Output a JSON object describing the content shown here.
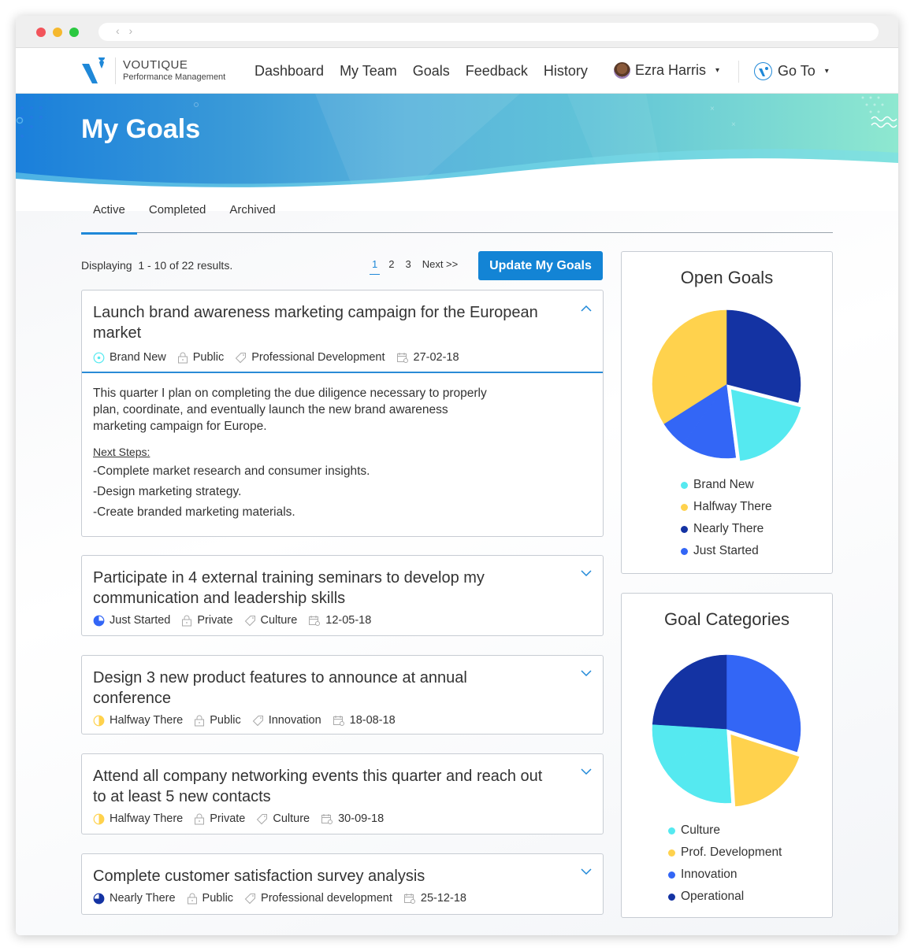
{
  "browser": {
    "nav_arrows": "‹ ›"
  },
  "brand": {
    "name": "VOUTIQUE",
    "subtitle": "Performance Management",
    "accent_color": "#1f88d8"
  },
  "nav": {
    "items": [
      {
        "label": "Dashboard"
      },
      {
        "label": "My Team"
      },
      {
        "label": "Goals"
      },
      {
        "label": "Feedback"
      },
      {
        "label": "History"
      }
    ],
    "user_name": "Ezra Harris",
    "user_caret": "▾",
    "goto_label": "Go To",
    "goto_caret": "▾"
  },
  "page": {
    "title": "My Goals"
  },
  "tabs": [
    {
      "label": "Active",
      "active": true
    },
    {
      "label": "Completed",
      "active": false
    },
    {
      "label": "Archived",
      "active": false
    }
  ],
  "results_text": "Displaying  1 - 10 of 22 results.",
  "pagination": {
    "pages": [
      "1",
      "2",
      "3"
    ],
    "current": "1",
    "next_label": "Next >>"
  },
  "update_button": "Update My Goals",
  "status_colors": {
    "Brand New": "#55e9f0",
    "Halfway There": "#ffd24d",
    "Nearly There": "#1433a3",
    "Just Started": "#3366f6"
  },
  "goals": [
    {
      "title": "Launch brand awareness marketing campaign for the European market",
      "status": "Brand New",
      "visibility": "Public",
      "category": "Professional Development",
      "date": "27-02-18",
      "expanded": true,
      "description": "This quarter I plan on completing the due diligence necessary to properly plan, coordinate, and eventually launch the new brand awareness marketing campaign for Europe.",
      "next_steps_heading": "Next Steps:",
      "next_steps": [
        "-Complete market research and consumer insights.",
        "-Design marketing strategy.",
        "-Create branded marketing materials."
      ]
    },
    {
      "title": "Participate in 4 external training seminars to develop my communication and leadership skills",
      "status": "Just Started",
      "visibility": "Private",
      "category": "Culture",
      "date": "12-05-18",
      "expanded": false
    },
    {
      "title": "Design 3 new product features to announce at annual conference",
      "status": "Halfway There",
      "visibility": "Public",
      "category": "Innovation",
      "date": "18-08-18",
      "expanded": false
    },
    {
      "title": "Attend all company networking events this quarter and reach out to at least 5 new contacts",
      "status": "Halfway There",
      "visibility": "Private",
      "category": "Culture",
      "date": "30-09-18",
      "expanded": false
    },
    {
      "title": "Complete customer satisfaction survey analysis",
      "status": "Nearly There",
      "visibility": "Public",
      "category": "Professional development",
      "date": "25-12-18",
      "expanded": false
    }
  ],
  "chart_data": [
    {
      "type": "pie",
      "title": "Open Goals",
      "legend_position": "bottom",
      "slices": [
        {
          "label": "Nearly There",
          "value": 29,
          "color": "#1433a3",
          "exploded": false
        },
        {
          "label": "Brand New",
          "value": 19,
          "color": "#55e9f0",
          "exploded": true
        },
        {
          "label": "Just Started",
          "value": 12,
          "color": "#3366f6",
          "exploded": false
        },
        {
          "label": "Just Started",
          "value": 6,
          "color": "#3366f6",
          "exploded": false
        },
        {
          "label": "Halfway There",
          "value": 12,
          "color": "#ffd24d",
          "exploded": false
        },
        {
          "label": "Halfway There",
          "value": 22,
          "color": "#ffd24d",
          "exploded": false
        }
      ],
      "legend": [
        {
          "label": "Brand New",
          "color": "#55e9f0"
        },
        {
          "label": "Halfway There",
          "color": "#ffd24d"
        },
        {
          "label": "Nearly There",
          "color": "#1433a3"
        },
        {
          "label": "Just Started",
          "color": "#3366f6"
        }
      ]
    },
    {
      "type": "pie",
      "title": "Goal Categories",
      "legend_position": "bottom",
      "slices": [
        {
          "label": "Innovation",
          "value": 30,
          "color": "#3366f6",
          "exploded": false
        },
        {
          "label": "Prof. Development",
          "value": 19,
          "color": "#ffd24d",
          "exploded": true
        },
        {
          "label": "Culture",
          "value": 11,
          "color": "#55e9f0",
          "exploded": false
        },
        {
          "label": "Culture",
          "value": 6,
          "color": "#55e9f0",
          "exploded": false
        },
        {
          "label": "Culture",
          "value": 10,
          "color": "#55e9f0",
          "exploded": false
        },
        {
          "label": "Operational",
          "value": 24,
          "color": "#1433a3",
          "exploded": false
        }
      ],
      "legend": [
        {
          "label": "Culture",
          "color": "#55e9f0"
        },
        {
          "label": "Prof. Development",
          "color": "#ffd24d"
        },
        {
          "label": "Innovation",
          "color": "#3366f6"
        },
        {
          "label": "Operational",
          "color": "#1433a3"
        }
      ]
    }
  ]
}
